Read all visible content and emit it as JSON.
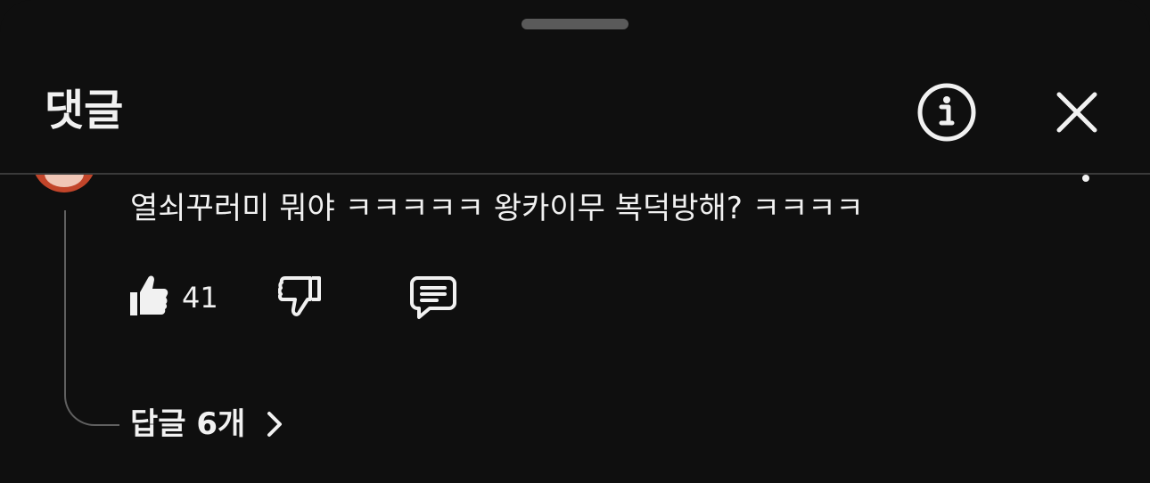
{
  "header": {
    "title": "댓글",
    "info_icon": "info-circle-icon",
    "close_icon": "close-icon"
  },
  "comment": {
    "text": "열쇠꾸러미 뭐야 ㅋㅋㅋㅋㅋ 왕카이무 복덕방해? ㅋㅋㅋㅋ",
    "like_count": "41",
    "like_icon": "thumbs-up-icon",
    "dislike_icon": "thumbs-down-icon",
    "reply_icon": "reply-icon",
    "replies_label": "답글 6개"
  },
  "colors": {
    "background": "#0f0f0f",
    "text": "#f1f1f1",
    "divider": "#3a3a3a",
    "handle": "#5a5a5a",
    "avatar": "#c2452a"
  }
}
